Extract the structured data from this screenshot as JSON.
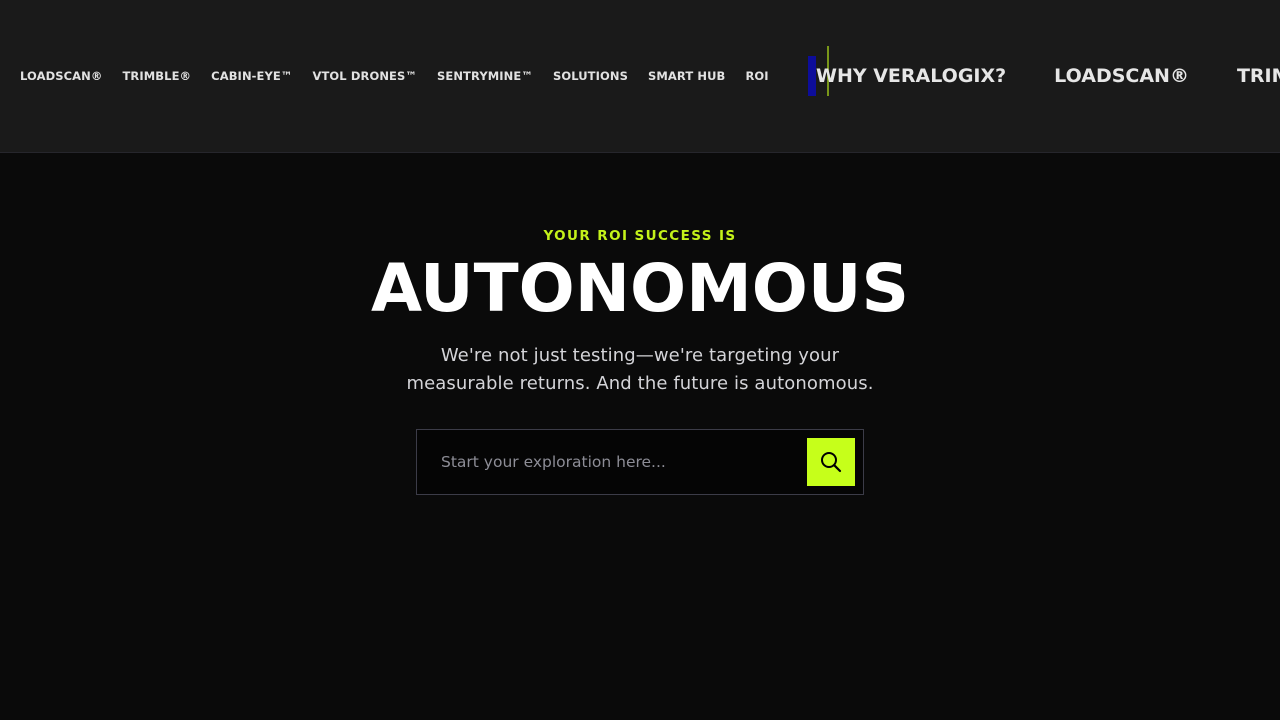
{
  "header": {
    "nav": [
      {
        "label": "LOADSCAN®"
      },
      {
        "label": "TRIMBLE®"
      },
      {
        "label": "CABIN-EYE™"
      },
      {
        "label": "VTOL DRONES™"
      },
      {
        "label": "SENTRYMINE™"
      },
      {
        "label": "SOLUTIONS"
      },
      {
        "label": "SMART HUB"
      },
      {
        "label": "ROI"
      }
    ],
    "ticker": [
      {
        "label": "WHY VERALOGIX?"
      },
      {
        "label": "LOADSCAN®"
      },
      {
        "label": "TRIMBLE®"
      }
    ]
  },
  "hero": {
    "eyebrow": "YOUR ROI SUCCESS IS",
    "headline": "AUTONOMOUS",
    "subtitle_line1": "We're not just testing—we're targeting your",
    "subtitle_line2": "measurable returns. And the future is autonomous."
  },
  "search": {
    "placeholder": "Start your exploration here...",
    "button_icon": "search-icon"
  },
  "colors": {
    "accent": "#c6ff1a",
    "background": "#0a0a0a",
    "header_bg": "#1a1a1a"
  }
}
